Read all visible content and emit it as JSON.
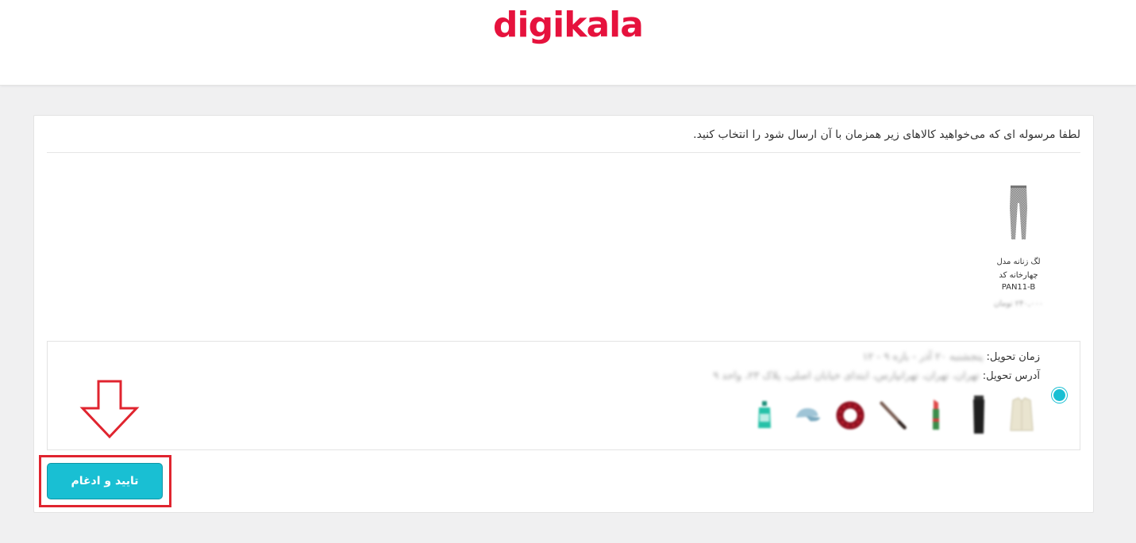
{
  "header": {
    "logo_text": "digikala",
    "logo_color": "#e6123d"
  },
  "main": {
    "instruction": "لطفا مرسوله ای که می‌خواهید کالاهای زیر همزمان با آن ارسال شود را انتخاب کنید.",
    "product": {
      "name": "لگ زنانه مدل چهارخانه کد",
      "code": "PAN11-B",
      "price": "۲۴۰,۰۰۰ تومان",
      "icon": "leggings-icon"
    },
    "shipment": {
      "delivery_time_label": "زمان تحویل:",
      "delivery_time_value": "پنجشنبه ۲۰ آذر - بازه ۹ - ۱۲",
      "delivery_address_label": "آدرس تحویل:",
      "delivery_address_value": "تهران، تهران، تهرانپارس، ابتدای خیابان اصلی، پلاک ۲۳، واحد ۹",
      "selected": true,
      "thumbnails": [
        "shirt-icon",
        "tube-icon",
        "lipstick-icon",
        "pencil-icon",
        "scrunchie-icon",
        "cap-icon",
        "bottle-icon"
      ]
    },
    "confirm_button": "تایید و ادغام"
  },
  "colors": {
    "accent": "#19bfd3",
    "annotation": "#e0242f"
  }
}
